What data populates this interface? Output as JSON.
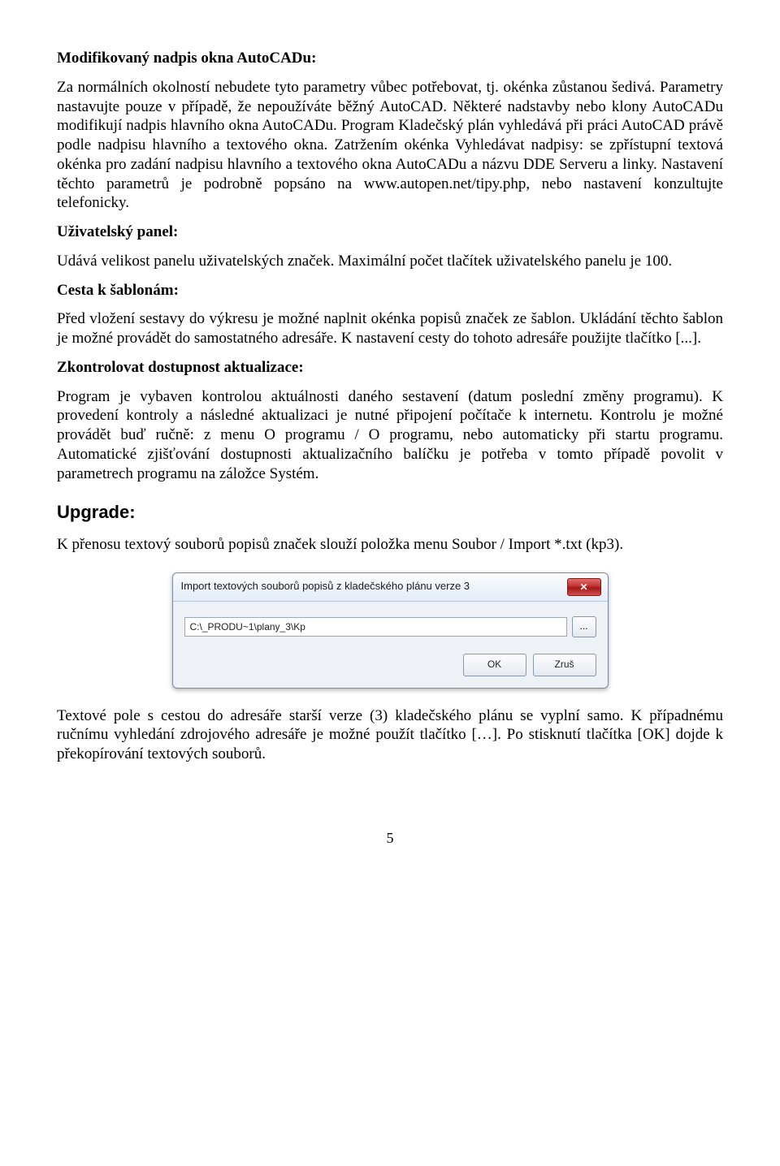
{
  "sections": {
    "s1": {
      "heading": "Modifikovaný nadpis okna AutoCADu:",
      "body": "Za normálních okolností nebudete tyto parametry vůbec potřebovat, tj. okénka zůstanou šedivá. Parametry nastavujte pouze v případě, že nepoužíváte běžný AutoCAD. Některé nadstavby nebo klony AutoCADu modifikují nadpis hlavního okna AutoCADu. Program Kladečský plán vyhledává při práci AutoCAD právě podle nadpisu hlavního a textového okna. Zatržením okénka Vyhledávat nadpisy: se zpřístupní textová okénka pro zadání nadpisu hlavního a textového okna AutoCADu a názvu DDE Serveru a linky. Nastavení těchto parametrů je podrobně popsáno na www.autopen.net/tipy.php, nebo nastavení konzultujte telefonicky."
    },
    "s2": {
      "heading": "Uživatelský panel:",
      "body": "Udává velikost panelu uživatelských značek. Maximální počet tlačítek uživatelského panelu je 100."
    },
    "s3": {
      "heading": "Cesta k šablonám:",
      "body": "Před vložení sestavy do výkresu je možné naplnit okénka popisů značek ze šablon. Ukládání těchto šablon je možné provádět do samostatného adresáře. K nastavení cesty do tohoto adresáře použijte tlačítko [...]."
    },
    "s4": {
      "heading": "Zkontrolovat dostupnost aktualizace:",
      "body": "Program je vybaven kontrolou aktuálnosti daného sestavení (datum poslední změny programu). K provedení kontroly a následné aktualizaci je nutné připojení počítače k internetu. Kontrolu je možné provádět buď ručně: z menu O programu / O programu, nebo automaticky při startu programu. Automatické zjišťování dostupnosti aktualizačního balíčku je potřeba v tomto případě povolit v parametrech programu na záložce Systém."
    },
    "upgrade": {
      "heading": "Upgrade:",
      "body_before": "K přenosu textový souborů popisů značek slouží položka menu Soubor / Import *.txt (kp3).",
      "body_after": "Textové pole s cestou do adresáře starší verze (3) kladečského plánu se vyplní samo. K případnému ručnímu vyhledání zdrojového adresáře je možné použít tlačítko […]. Po stisknutí tlačítka [OK] dojde k překopírování textových souborů."
    }
  },
  "dialog": {
    "title": "Import textových souborů popisů z kladečského plánu verze 3",
    "path": "C:\\_PRODU~1\\plany_3\\Kp",
    "browse": "...",
    "ok": "OK",
    "cancel": "Zruš",
    "close_x": "✕"
  },
  "page_number": "5"
}
